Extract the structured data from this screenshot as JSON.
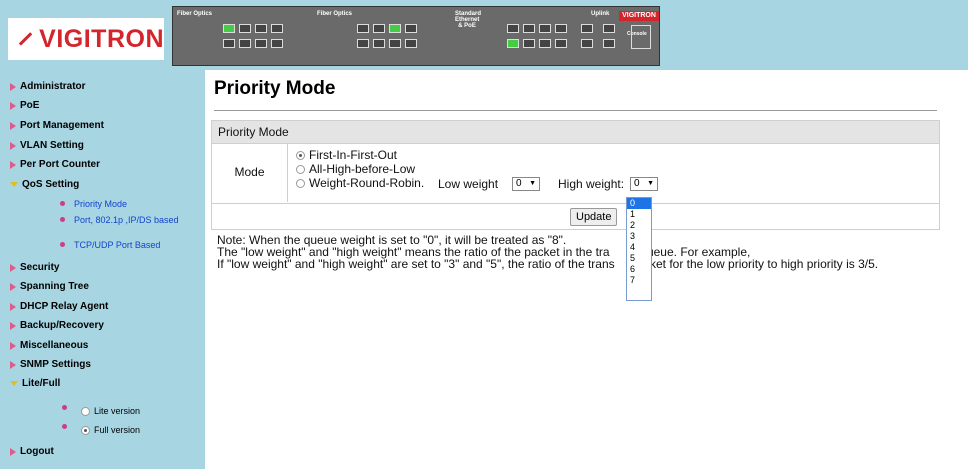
{
  "header": {
    "brand": "VIGITRON",
    "switch": {
      "label_fiber_left": "Fiber Optics",
      "label_fiber_mid": "Fiber Optics",
      "label_standard": "Standard Ethernet & PoE",
      "label_uplink": "Uplink",
      "label_console": "Console",
      "brand": "VIGITRON",
      "top_numbers_left": [
        "1",
        "3",
        "5",
        "7"
      ],
      "bottom_numbers_left": [
        "2",
        "4",
        "6",
        "8"
      ],
      "top_numbers_mid": [
        "9",
        "11",
        "13",
        "15"
      ],
      "bottom_numbers_mid": [
        "10",
        "12",
        "14",
        "16"
      ],
      "top_numbers_right": [
        "17",
        "19",
        "21",
        "23"
      ],
      "bottom_numbers_right": [
        "18",
        "20",
        "22",
        "24"
      ],
      "uplink_top": [
        "25"
      ],
      "uplink_bottom": [
        "26"
      ]
    }
  },
  "sidebar": {
    "items": [
      {
        "label": "Administrator"
      },
      {
        "label": "PoE"
      },
      {
        "label": "Port Management"
      },
      {
        "label": "VLAN Setting"
      },
      {
        "label": "Per Port Counter"
      },
      {
        "label": "QoS Setting"
      },
      {
        "label": "Security"
      },
      {
        "label": "Spanning Tree"
      },
      {
        "label": "DHCP Relay Agent"
      },
      {
        "label": "Backup/Recovery"
      },
      {
        "label": "Miscellaneous"
      },
      {
        "label": "SNMP Settings"
      },
      {
        "label": "Lite/Full"
      },
      {
        "label": "Logout"
      }
    ],
    "qos_sub": [
      {
        "label": "Priority Mode"
      },
      {
        "label": "Port, 802.1p ,IP/DS based"
      },
      {
        "label": "TCP/UDP Port Based"
      }
    ],
    "version": [
      {
        "label": "Lite version",
        "selected": false
      },
      {
        "label": "Full version",
        "selected": true
      }
    ]
  },
  "main": {
    "page_title": "Priority Mode",
    "panel_title": "Priority Mode",
    "mode_label": "Mode",
    "options": [
      {
        "label": "First-In-First-Out",
        "selected": true
      },
      {
        "label": "All-High-before-Low",
        "selected": false
      },
      {
        "label": "Weight-Round-Robin.",
        "selected": false
      }
    ],
    "low_weight_label": "Low weight",
    "low_weight_value": "0",
    "high_weight_label": "High weight:",
    "high_weight_value": "0",
    "update_button": "Update",
    "note_lines": [
      "Note:  When the queue weight is set to \"0\", it will be treated as \"8\".",
      "The \"low weight\" and \"high weight\" means the ratio of the packet in the tra",
      "If \"low weight\" and \"high weight\" are set to \"3\" and \"5\", the ratio of the trans"
    ],
    "note_tail_lines": [
      "t queue. For example,",
      "packet for the low priority to high priority is 3/5."
    ],
    "dropdown_options": [
      "0",
      "1",
      "2",
      "3",
      "4",
      "5",
      "6",
      "7"
    ],
    "dropdown_selected": "0"
  }
}
